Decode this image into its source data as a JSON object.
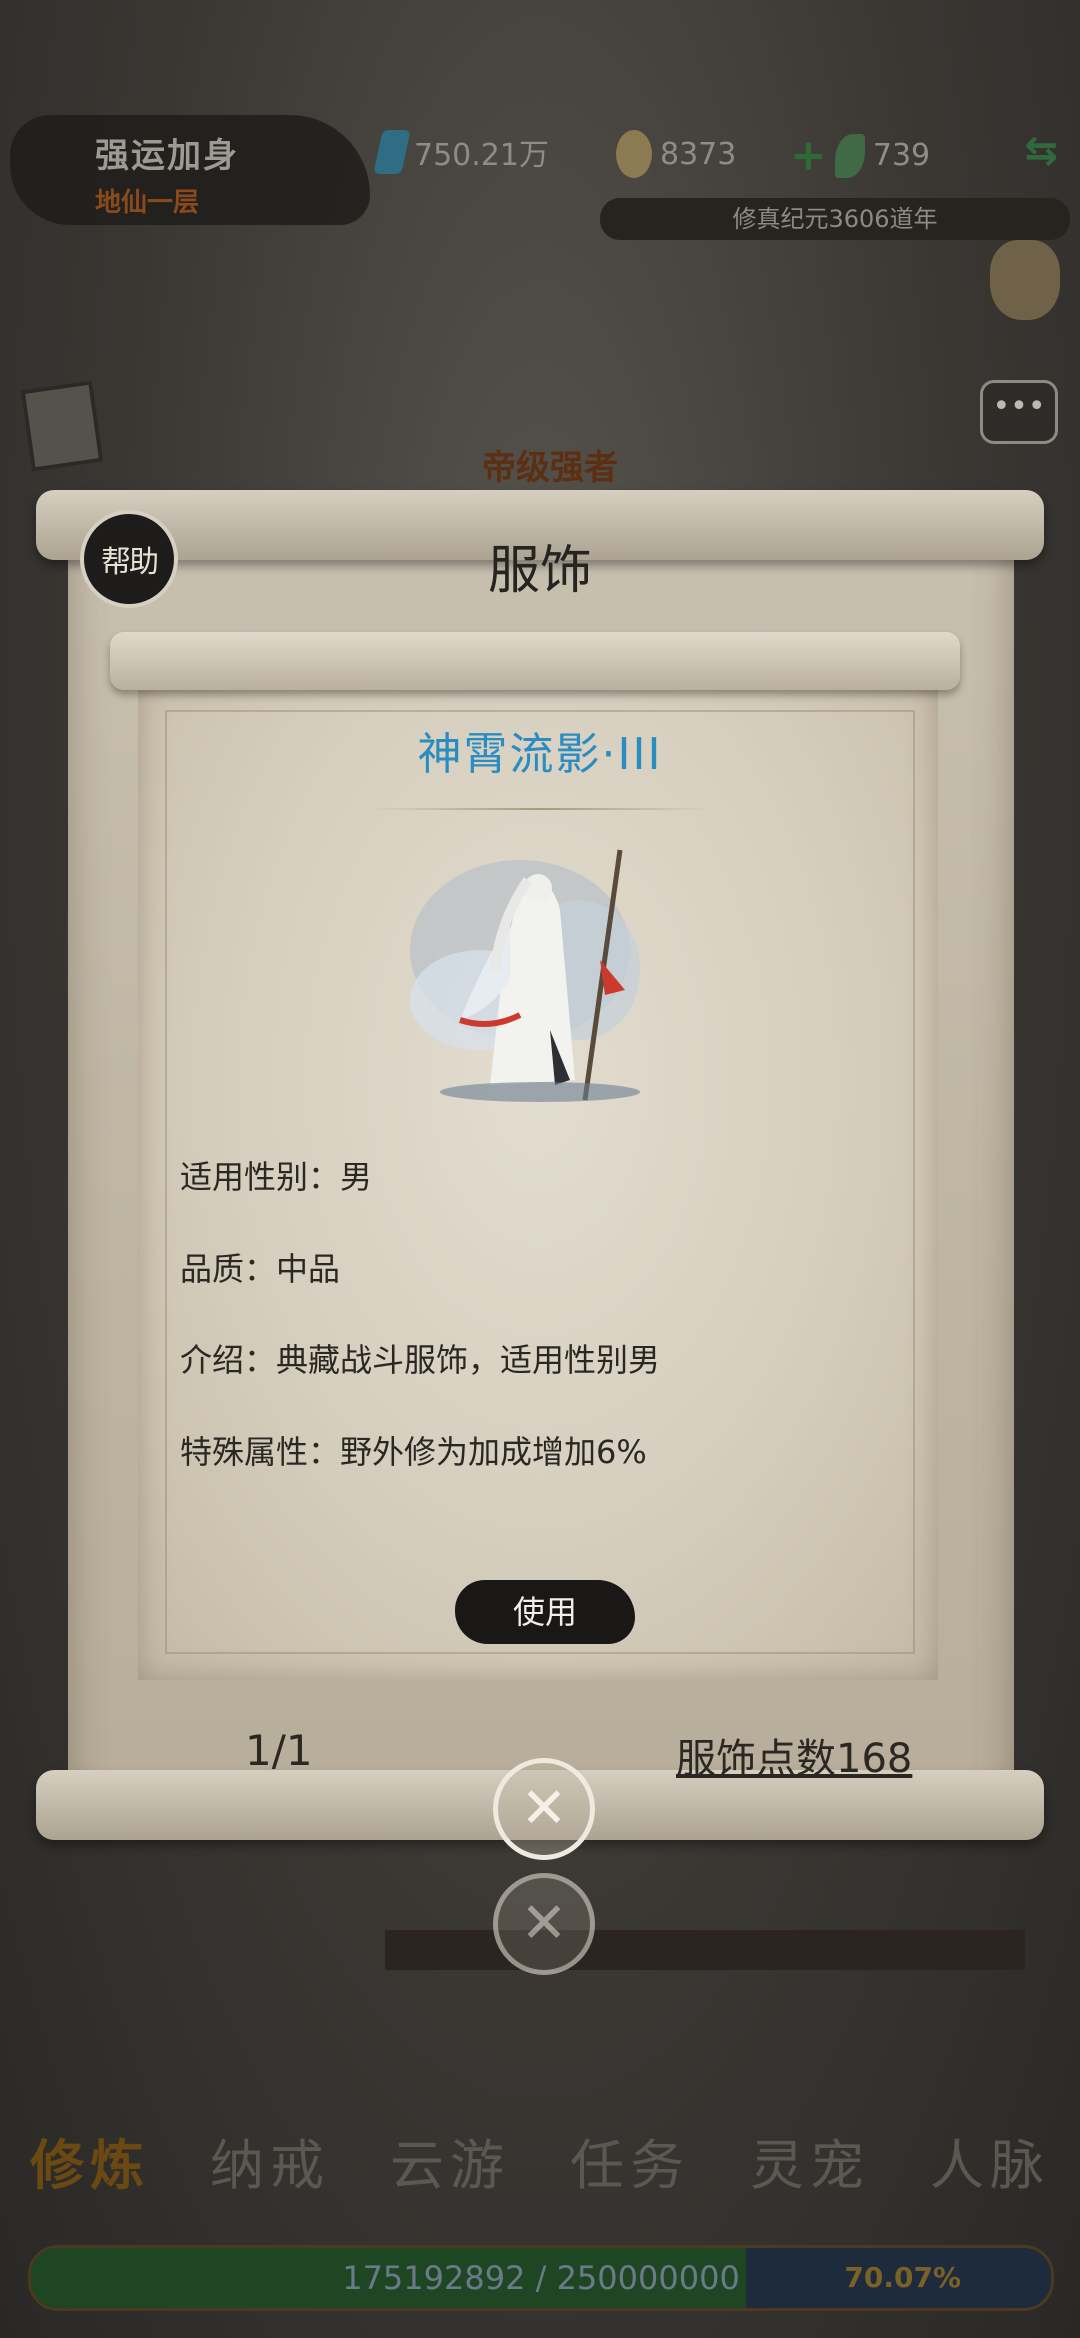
{
  "status": {
    "title": "强运加身",
    "realm": "地仙一层",
    "spirit_stones": "750.21万",
    "gold": "8373",
    "herbs": "739",
    "era": "修真纪元3606道年"
  },
  "background": {
    "ribbon_title": "帝级强者",
    "chat_label": "•••"
  },
  "popup": {
    "help_label": "帮助",
    "title": "服饰",
    "item": {
      "name": "神霄流影·III",
      "attributes": [
        "适用性别：男",
        "品质：中品",
        "介绍：典藏战斗服饰，适用性别男",
        "特殊属性：野外修为加成增加6%"
      ]
    },
    "use_label": "使用",
    "pager": "1/1",
    "points_label": "服饰点数168"
  },
  "nav": {
    "items": [
      "修炼",
      "纳戒",
      "云游",
      "任务",
      "灵宠",
      "人脉"
    ],
    "active": 0
  },
  "xp": {
    "text": "175192892 / 250000000",
    "percent": "70.07%",
    "fraction": 0.7007
  },
  "colors": {
    "item_name": "#2a8cc0",
    "scroll_paper": "#c8c0b0"
  }
}
